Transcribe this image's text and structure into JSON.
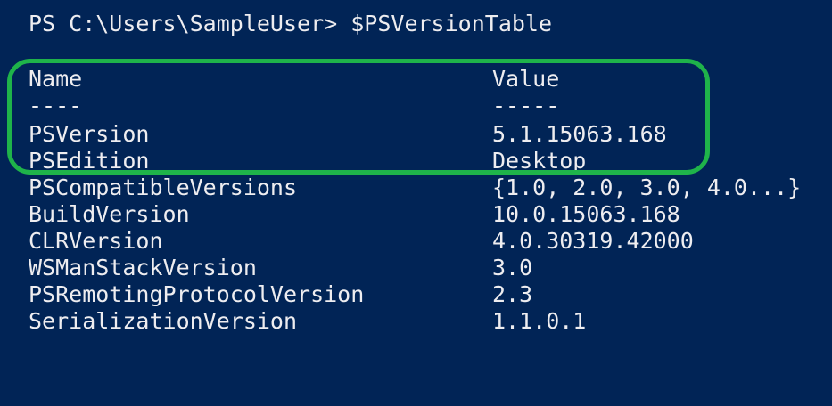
{
  "console": {
    "prompt": "PS C:\\Users\\SampleUser>",
    "command": "$PSVersionTable",
    "header": {
      "name": "Name",
      "value": "Value"
    },
    "separator": {
      "name": "----",
      "value": "-----"
    },
    "rows": [
      {
        "name": "PSVersion",
        "value": "5.1.15063.168"
      },
      {
        "name": "PSEdition",
        "value": "Desktop"
      },
      {
        "name": "PSCompatibleVersions",
        "value": "{1.0, 2.0, 3.0, 4.0...}"
      },
      {
        "name": "BuildVersion",
        "value": "10.0.15063.168"
      },
      {
        "name": "CLRVersion",
        "value": "4.0.30319.42000"
      },
      {
        "name": "WSManStackVersion",
        "value": "3.0"
      },
      {
        "name": "PSRemotingProtocolVersion",
        "value": "2.3"
      },
      {
        "name": "SerializationVersion",
        "value": "1.1.0.1"
      }
    ]
  },
  "colors": {
    "background": "#012456",
    "text": "#eeedf0",
    "highlight": "#1fb34a"
  }
}
